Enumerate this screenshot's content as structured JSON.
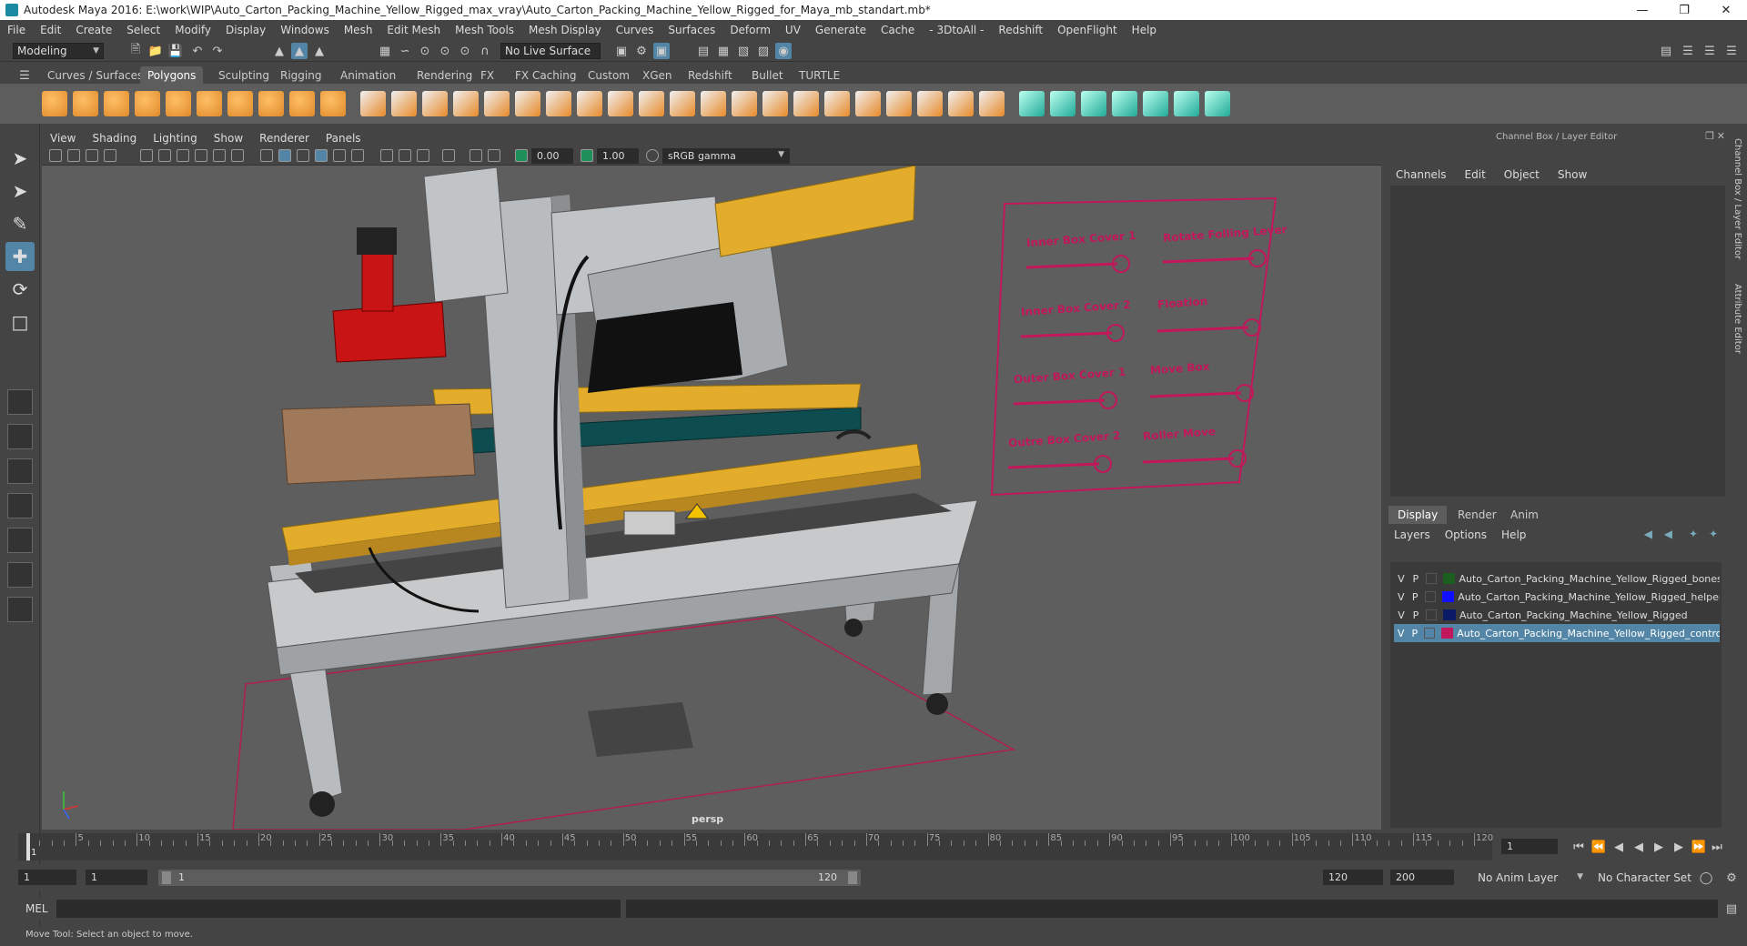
{
  "window": {
    "title": "Autodesk Maya 2016: E:\\work\\WIP\\Auto_Carton_Packing_Machine_Yellow_Rigged_max_vray\\Auto_Carton_Packing_Machine_Yellow_Rigged_for_Maya_mb_standart.mb*"
  },
  "menu": [
    "File",
    "Edit",
    "Create",
    "Select",
    "Modify",
    "Display",
    "Windows",
    "Mesh",
    "Edit Mesh",
    "Mesh Tools",
    "Mesh Display",
    "Curves",
    "Surfaces",
    "Deform",
    "UV",
    "Generate",
    "Cache",
    "- 3DtoAll -",
    "Redshift",
    "OpenFlight",
    "Help"
  ],
  "status": {
    "mode": "Modeling",
    "live_surface": "No Live Surface"
  },
  "shelf_tabs": [
    "Curves / Surfaces",
    "Polygons",
    "Sculpting",
    "Rigging",
    "Animation",
    "Rendering",
    "FX",
    "FX Caching",
    "Custom",
    "XGen",
    "Redshift",
    "Bullet",
    "TURTLE"
  ],
  "shelf_active": "Polygons",
  "viewport": {
    "menu": [
      "View",
      "Shading",
      "Lighting",
      "Show",
      "Renderer",
      "Panels"
    ],
    "exposure": "0.00",
    "gamma": "1.00",
    "color_space": "sRGB gamma",
    "camera": "persp"
  },
  "controls": {
    "labels": [
      "Inner Box Cover 1",
      "Rotate Folling Lever",
      "Inner Box Cover 2",
      "Floation",
      "Outer Box Cover 1",
      "Move Box",
      "Outre Box Cover 2",
      "Roller Move"
    ]
  },
  "channel_box": {
    "header": "Channel Box / Layer Editor",
    "menu": [
      "Channels",
      "Edit",
      "Object",
      "Show"
    ],
    "side_tabs": [
      "Channel Box / Layer Editor",
      "Attribute Editor"
    ]
  },
  "layer_editor": {
    "tabs": [
      "Display",
      "Render",
      "Anim"
    ],
    "active_tab": "Display",
    "menu": [
      "Layers",
      "Options",
      "Help"
    ],
    "layers": [
      {
        "v": "V",
        "p": "P",
        "color": "#1b5e20",
        "name": "Auto_Carton_Packing_Machine_Yellow_Rigged_bones",
        "selected": false
      },
      {
        "v": "V",
        "p": "P",
        "color": "#1010ff",
        "name": "Auto_Carton_Packing_Machine_Yellow_Rigged_helpers",
        "selected": false
      },
      {
        "v": "V",
        "p": "P",
        "color": "#0b1a66",
        "name": "Auto_Carton_Packing_Machine_Yellow_Rigged",
        "selected": false
      },
      {
        "v": "V",
        "p": "P",
        "color": "#c2185b",
        "name": "Auto_Carton_Packing_Machine_Yellow_Rigged_controlle",
        "selected": true
      }
    ]
  },
  "timeline": {
    "ticks": [
      5,
      10,
      15,
      20,
      25,
      30,
      35,
      40,
      45,
      50,
      55,
      60,
      65,
      70,
      75,
      80,
      85,
      90,
      95,
      100,
      105,
      110,
      115,
      120
    ],
    "current_frame_label": "1",
    "current_frame": "1"
  },
  "range": {
    "start": "1",
    "playback_start": "1",
    "slider_start": "1",
    "slider_end": "120",
    "playback_end": "120",
    "end": "200",
    "anim_layer": "No Anim Layer",
    "character_set": "No Character Set"
  },
  "cmd": {
    "label": "MEL"
  },
  "help": {
    "text": "Move Tool: Select an object to move."
  }
}
